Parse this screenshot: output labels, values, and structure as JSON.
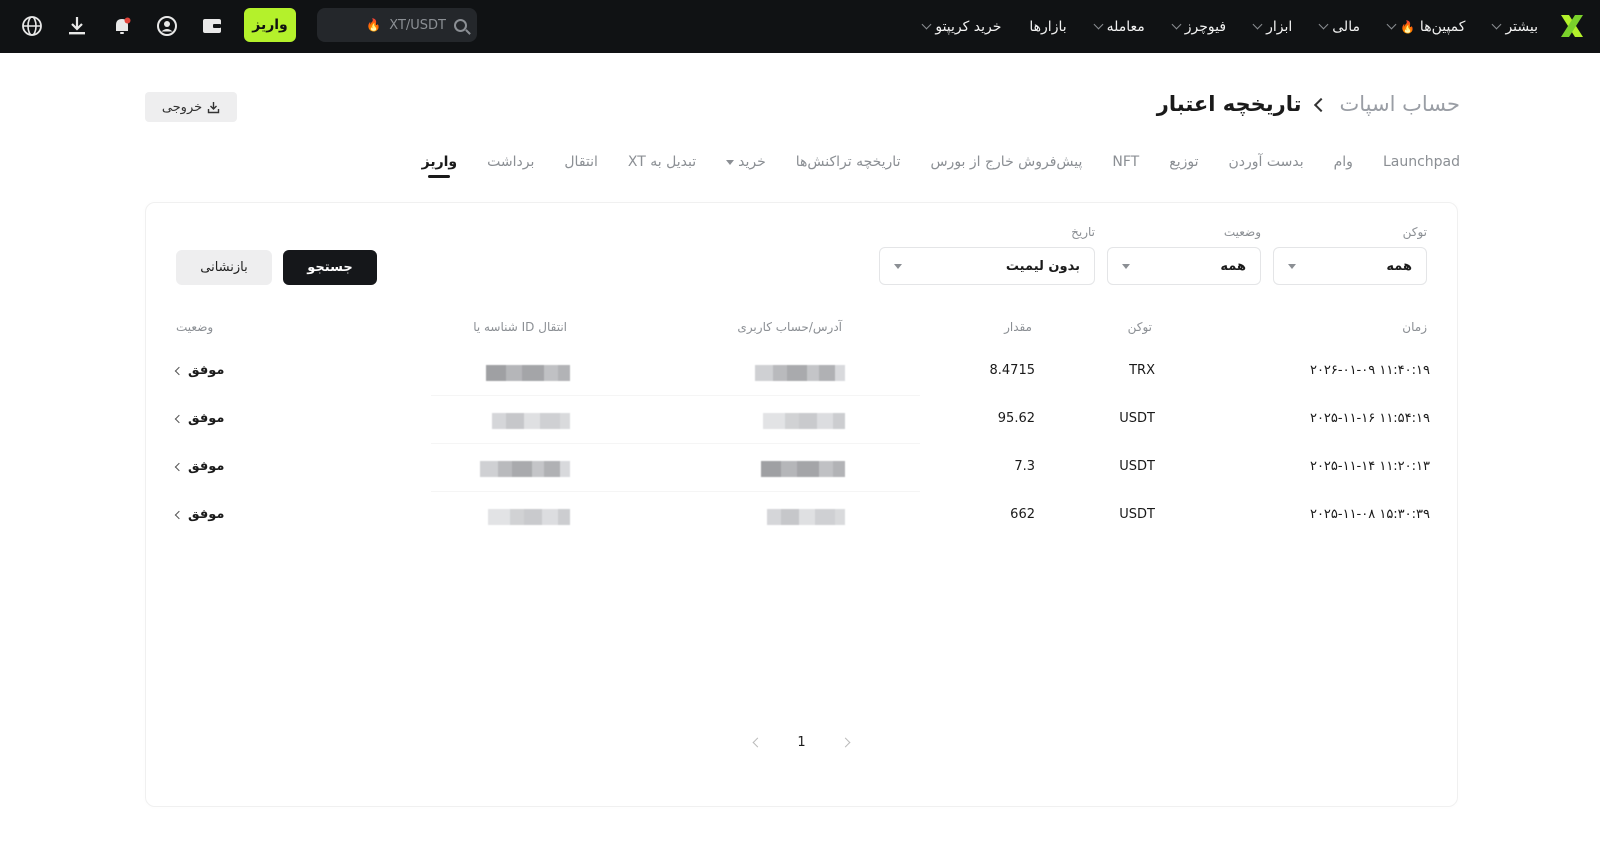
{
  "topbar": {
    "nav": [
      {
        "label": "خرید کریپتو",
        "chevron": true,
        "fire": false
      },
      {
        "label": "بازارها",
        "chevron": false,
        "fire": false
      },
      {
        "label": "معامله",
        "chevron": true,
        "fire": false
      },
      {
        "label": "فیوچرز",
        "chevron": true,
        "fire": false
      },
      {
        "label": "ابزار",
        "chevron": true,
        "fire": false
      },
      {
        "label": "مالی",
        "chevron": true,
        "fire": false
      },
      {
        "label": "کمپین‌ها",
        "chevron": true,
        "fire": true
      },
      {
        "label": "بیشتر",
        "chevron": true,
        "fire": false
      }
    ],
    "search_placeholder": "XT/USDT",
    "deposit_label": "واریز",
    "icons": [
      "wallet-icon",
      "user-icon",
      "bell-icon",
      "download-icon",
      "globe-icon"
    ],
    "accent": "#b4f12b"
  },
  "header": {
    "export_label": "خروجی",
    "breadcrumb_root": "حساب اسپات",
    "breadcrumb_current": "تاریخچه اعتبار"
  },
  "tabs": [
    {
      "label": "واریز",
      "active": true,
      "dropdown": false
    },
    {
      "label": "برداشت",
      "active": false,
      "dropdown": false
    },
    {
      "label": "انتقال",
      "active": false,
      "dropdown": false
    },
    {
      "label": "تبدیل به XT",
      "active": false,
      "dropdown": false
    },
    {
      "label": "خرید",
      "active": false,
      "dropdown": true
    },
    {
      "label": "تاریخچه تراکنش‌ها",
      "active": false,
      "dropdown": false
    },
    {
      "label": "پیش‌فروش خارج از بورس",
      "active": false,
      "dropdown": false
    },
    {
      "label": "NFT",
      "active": false,
      "dropdown": false
    },
    {
      "label": "توزیع",
      "active": false,
      "dropdown": false
    },
    {
      "label": "بدست آوردن",
      "active": false,
      "dropdown": false
    },
    {
      "label": "وام",
      "active": false,
      "dropdown": false
    },
    {
      "label": "Launchpad",
      "active": false,
      "dropdown": false
    }
  ],
  "filters": {
    "token_label": "توکن",
    "token_value": "همه",
    "status_label": "وضعیت",
    "status_value": "همه",
    "date_label": "تاریخ",
    "date_value": "بدون لیمیت",
    "search_button": "جستجو",
    "reset_button": "بازنشانی"
  },
  "table": {
    "headers": {
      "time": "زمان",
      "token": "توکن",
      "amount": "مقدار",
      "address": "آدرس/حساب کاربری",
      "txid": "شناسه یا ID انتقال",
      "status": "وضعیت"
    },
    "rows": [
      {
        "time": "۲۰۲۶-۰۱-۰۹ ۱۱:۴۰:۱۹",
        "token": "TRX",
        "amount": "8.4715",
        "status": "موفق"
      },
      {
        "time": "۲۰۲۵-۱۱-۱۶ ۱۱:۵۴:۱۹",
        "token": "USDT",
        "amount": "95.62",
        "status": "موفق"
      },
      {
        "time": "۲۰۲۵-۱۱-۱۴ ۱۱:۲۰:۱۳",
        "token": "USDT",
        "amount": "7.3",
        "status": "موفق"
      },
      {
        "time": "۲۰۲۵-۱۱-۰۸ ۱۵:۳۰:۳۹",
        "token": "USDT",
        "amount": "662",
        "status": "موفق"
      }
    ]
  },
  "pagination": {
    "current": "1"
  }
}
